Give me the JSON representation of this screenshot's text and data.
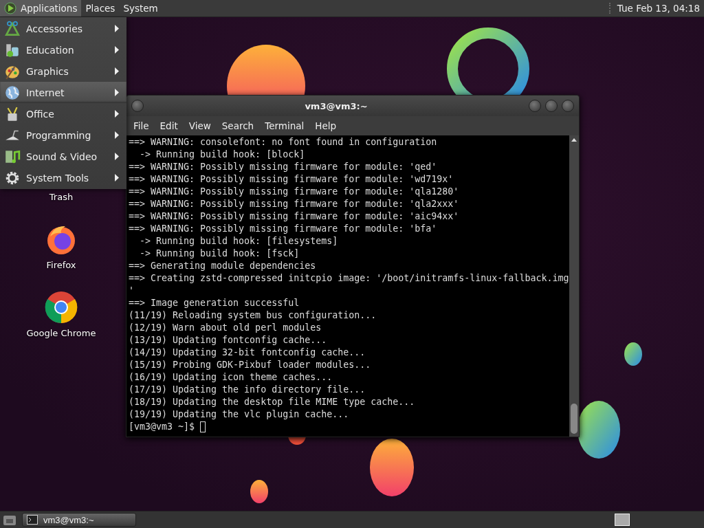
{
  "top_panel": {
    "menus": [
      {
        "label": "Applications",
        "selected": true
      },
      {
        "label": "Places",
        "selected": false
      },
      {
        "label": "System",
        "selected": false
      }
    ],
    "clock": "Tue Feb 13, 04:18"
  },
  "applications_menu": {
    "items": [
      {
        "label": "Accessories",
        "selected": false
      },
      {
        "label": "Education",
        "selected": false
      },
      {
        "label": "Graphics",
        "selected": false
      },
      {
        "label": "Internet",
        "selected": true
      },
      {
        "label": "Office",
        "selected": false
      },
      {
        "label": "Programming",
        "selected": false
      },
      {
        "label": "Sound & Video",
        "selected": false
      },
      {
        "label": "System Tools",
        "selected": false
      }
    ]
  },
  "desktop_icons": [
    {
      "label": "Trash"
    },
    {
      "label": "Firefox",
      "kind": "firefox"
    },
    {
      "label": "Google Chrome",
      "kind": "chrome"
    }
  ],
  "terminal": {
    "title": "vm3@vm3:~",
    "menu": [
      "File",
      "Edit",
      "View",
      "Search",
      "Terminal",
      "Help"
    ],
    "lines": [
      "==> WARNING: consolefont: no font found in configuration",
      "  -> Running build hook: [block]",
      "==> WARNING: Possibly missing firmware for module: 'qed'",
      "==> WARNING: Possibly missing firmware for module: 'wd719x'",
      "==> WARNING: Possibly missing firmware for module: 'qla1280'",
      "==> WARNING: Possibly missing firmware for module: 'qla2xxx'",
      "==> WARNING: Possibly missing firmware for module: 'aic94xx'",
      "==> WARNING: Possibly missing firmware for module: 'bfa'",
      "  -> Running build hook: [filesystems]",
      "  -> Running build hook: [fsck]",
      "==> Generating module dependencies",
      "==> Creating zstd-compressed initcpio image: '/boot/initramfs-linux-fallback.img",
      "'",
      "==> Image generation successful",
      "(11/19) Reloading system bus configuration...",
      "(12/19) Warn about old perl modules",
      "(13/19) Updating fontconfig cache...",
      "(14/19) Updating 32-bit fontconfig cache...",
      "(15/19) Probing GDK-Pixbuf loader modules...",
      "(16/19) Updating icon theme caches...",
      "(17/19) Updating the info directory file...",
      "(18/19) Updating the desktop file MIME type cache...",
      "(19/19) Updating the vlc plugin cache..."
    ],
    "prompt": "[vm3@vm3 ~]$"
  },
  "taskbar": {
    "tasks": [
      {
        "label": "vm3@vm3:~"
      }
    ]
  }
}
